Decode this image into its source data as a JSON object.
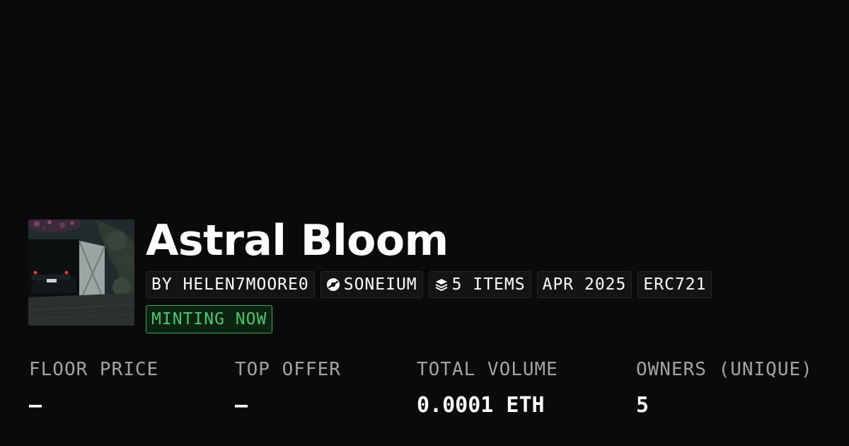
{
  "collection": {
    "title": "Astral Bloom",
    "creator": "BY HELEN7MOORE0",
    "chain": "SONEIUM",
    "chain_icon": "soneium-logo-icon",
    "items": "5 ITEMS",
    "items_icon": "layers-icon",
    "date": "APR 2025",
    "standard": "ERC721",
    "status": "MINTING NOW",
    "thumbnail_icon": "car-garage-image"
  },
  "stats": [
    {
      "label": "FLOOR PRICE",
      "value": "–"
    },
    {
      "label": "TOP OFFER",
      "value": "–"
    },
    {
      "label": "TOTAL VOLUME",
      "value": "0.0001 ETH"
    },
    {
      "label": "OWNERS (UNIQUE)",
      "value": "5"
    }
  ],
  "colors": {
    "background": "#0a0a0a",
    "status_green": "#4ec46f",
    "label_gray": "#a3a3a3"
  }
}
